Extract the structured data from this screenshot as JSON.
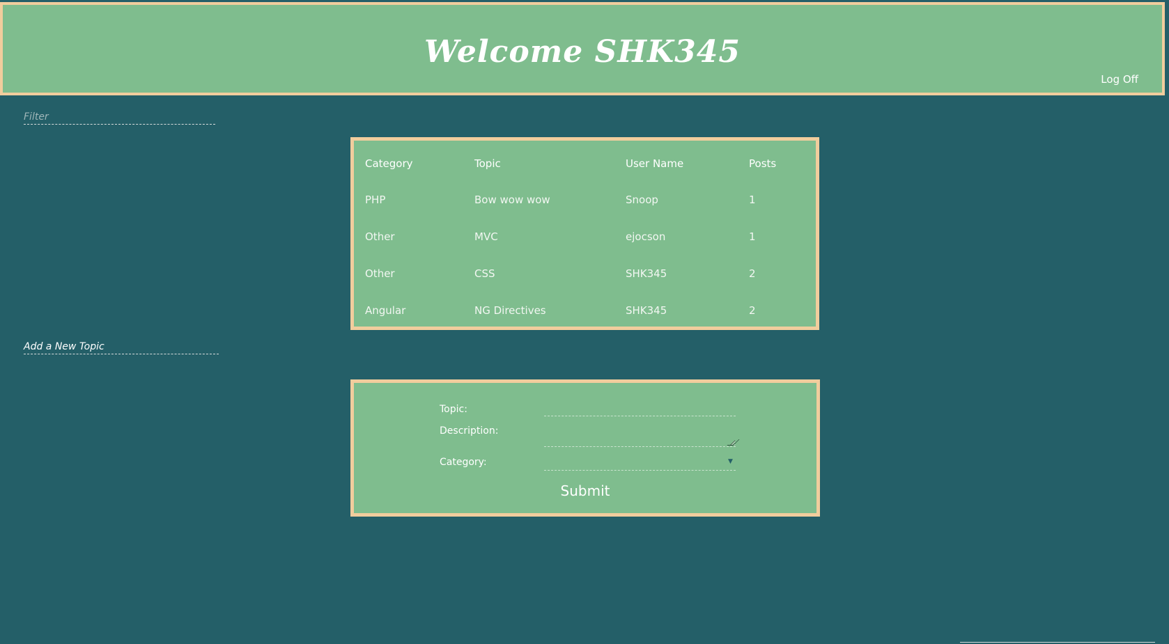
{
  "header": {
    "title": "Welcome SHK345",
    "logoff_label": "Log Off"
  },
  "filter": {
    "placeholder": "Filter",
    "value": ""
  },
  "table": {
    "headers": [
      "Category",
      "Topic",
      "User Name",
      "Posts"
    ],
    "rows": [
      [
        "PHP",
        "Bow wow wow",
        "Snoop",
        "1"
      ],
      [
        "Other",
        "MVC",
        "ejocson",
        "1"
      ],
      [
        "Other",
        "CSS",
        "SHK345",
        "2"
      ],
      [
        "Angular",
        "NG Directives",
        "SHK345",
        "2"
      ]
    ]
  },
  "add_topic": {
    "label": "Add a New Topic"
  },
  "form": {
    "topic_label": "Topic:",
    "topic_value": "",
    "description_label": "Description:",
    "description_value": "",
    "category_label": "Category:",
    "category_value": "",
    "submit_label": "Submit"
  },
  "colors": {
    "background": "#245f68",
    "panel": "#7fbd8e",
    "border": "#f1cd9d",
    "text": "#ffffff"
  }
}
